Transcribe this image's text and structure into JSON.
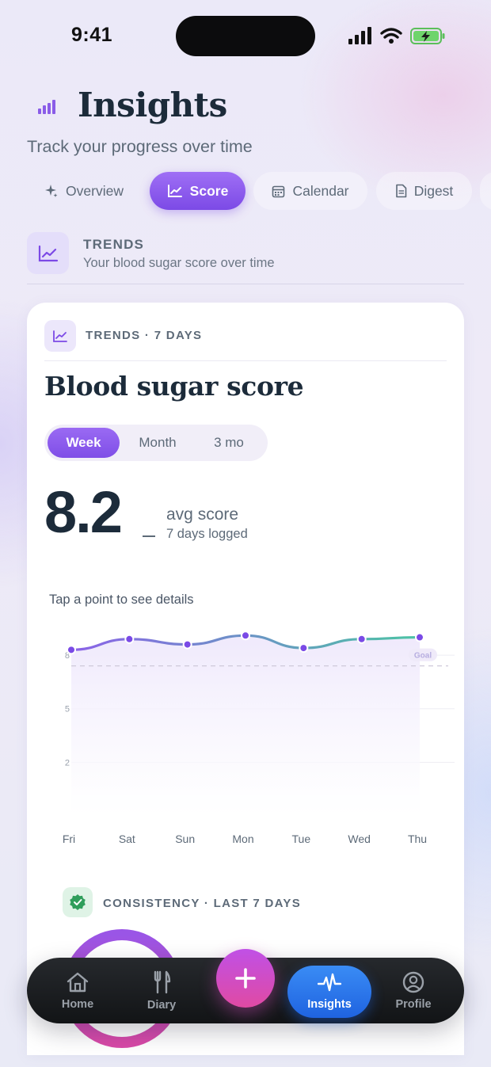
{
  "status_bar": {
    "time": "9:41"
  },
  "header": {
    "icon": "bar-chart-icon",
    "title": "Insights",
    "subtitle": "Track your progress over time"
  },
  "tabs": [
    {
      "label": "Overview",
      "icon": "sparkle-icon",
      "active": false
    },
    {
      "label": "Score",
      "icon": "trend-icon",
      "active": true
    },
    {
      "label": "Calendar",
      "icon": "calendar-icon",
      "active": false
    },
    {
      "label": "Digest",
      "icon": "document-icon",
      "active": false
    }
  ],
  "section": {
    "icon": "trend-icon",
    "label": "TRENDS",
    "description": "Your blood sugar score over time"
  },
  "card": {
    "kicker": "TRENDS · 7 DAYS",
    "title": "Blood sugar score",
    "range_options": [
      "Week",
      "Month",
      "3 mo"
    ],
    "selected_range": "Week",
    "average_value": "8.2",
    "average_label": "avg score",
    "days_logged": "7 days logged",
    "tap_hint": "Tap a point to see details",
    "consistency_label": "CONSISTENCY · LAST 7 DAYS"
  },
  "chart_data": {
    "type": "area",
    "categories": [
      "Fri",
      "Sat",
      "Sun",
      "Mon",
      "Tue",
      "Wed",
      "Thu"
    ],
    "values": [
      8.3,
      8.9,
      8.6,
      9.1,
      8.4,
      8.9,
      9.0
    ],
    "y_ticks": [
      2,
      5,
      8
    ],
    "ylim": [
      -1,
      10
    ],
    "goal_value": 7.4,
    "goal_label": "Goal",
    "grid": true,
    "colors": {
      "line_start": "#8b62e8",
      "line_end": "#4cc4a4",
      "point": "#7a4ae6",
      "fill": "#efe9fc"
    }
  },
  "bottom_nav": {
    "items": [
      {
        "label": "Home",
        "icon": "home-icon",
        "active": false
      },
      {
        "label": "Diary",
        "icon": "fork-knife-icon",
        "active": false
      },
      {
        "label": "Insights",
        "icon": "pulse-icon",
        "active": true
      },
      {
        "label": "Profile",
        "icon": "profile-icon",
        "active": false
      }
    ],
    "fab_icon": "plus-icon"
  },
  "colors": {
    "accent": "#7c4ae6",
    "nav_active": "#2a74ea",
    "fab": "#d04bc4"
  }
}
